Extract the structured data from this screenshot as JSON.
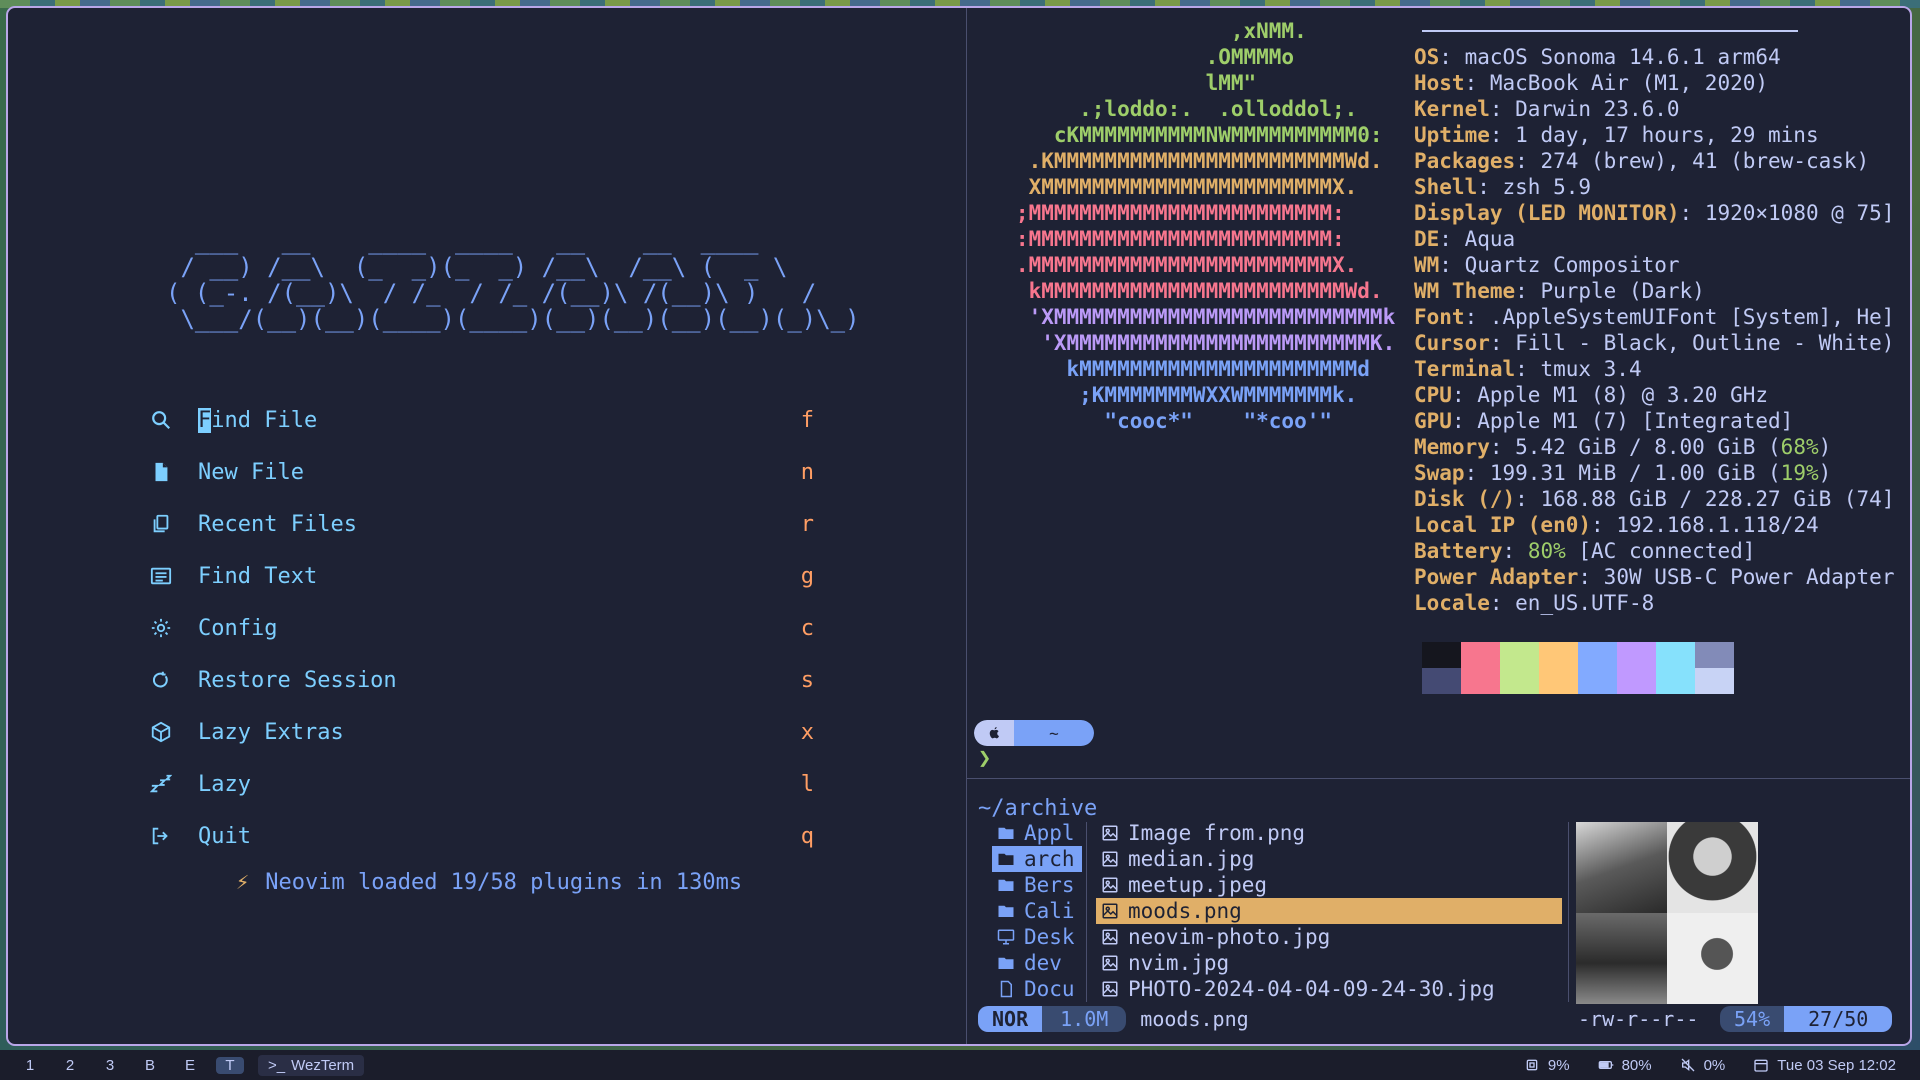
{
  "dashboard": {
    "logo_lines": [
      "  ___   __    ____  ____   __    __  ____ ",
      " / __) /__\\  (_  _)(_  _) /__\\  /__\\ (  _ \\",
      "( (_-. /(__)\\  / /_  / /_ /(__)\\ /(__)\\ )   /",
      " \\___/(__)(__)(____)(____)(__)(__)(__)(__)(_)\\_)"
    ],
    "menu": [
      {
        "icon": "search-icon",
        "label_first": "F",
        "label_rest": "ind File",
        "key": "f"
      },
      {
        "icon": "new-file-icon",
        "label": "New File",
        "key": "n"
      },
      {
        "icon": "recent-files-icon",
        "label": "Recent Files",
        "key": "r"
      },
      {
        "icon": "find-text-icon",
        "label": "Find Text",
        "key": "g"
      },
      {
        "icon": "gear-icon",
        "label": "Config",
        "key": "c"
      },
      {
        "icon": "restore-icon",
        "label": "Restore Session",
        "key": "s"
      },
      {
        "icon": "package-icon",
        "label": "Lazy Extras",
        "key": "x"
      },
      {
        "icon": "sleep-icon",
        "label": "Lazy",
        "key": "l"
      },
      {
        "icon": "quit-icon",
        "label": "Quit",
        "key": "q"
      }
    ],
    "status": "Neovim loaded 19/58 plugins in 130ms"
  },
  "fetch": {
    "ascii": [
      {
        "text": "                    ,xNMM.",
        "color": "#9ece6a"
      },
      {
        "text": "                  .OMMMMo",
        "color": "#9ece6a"
      },
      {
        "text": "                  lMM\"",
        "color": "#9ece6a"
      },
      {
        "text": "        .;loddo:.  .olloddol;.",
        "color": "#9ece6a"
      },
      {
        "text": "      cKMMMMMMMMMMNWMMMMMMMMMM0:",
        "color": "#9ece6a"
      },
      {
        "text": "    .KMMMMMMMMMMMMMMMMMMMMMMMWd.",
        "color": "#e0af68"
      },
      {
        "text": "    XMMMMMMMMMMMMMMMMMMMMMMMX.",
        "color": "#e0af68"
      },
      {
        "text": "   ;MMMMMMMMMMMMMMMMMMMMMMMM:",
        "color": "#f7768e"
      },
      {
        "text": "   :MMMMMMMMMMMMMMMMMMMMMMMM:",
        "color": "#f7768e"
      },
      {
        "text": "   .MMMMMMMMMMMMMMMMMMMMMMMMX.",
        "color": "#f7768e"
      },
      {
        "text": "    kMMMMMMMMMMMMMMMMMMMMMMMMWd.",
        "color": "#f7768e"
      },
      {
        "text": "    'XMMMMMMMMMMMMMMMMMMMMMMMMMMk",
        "color": "#bb9af7"
      },
      {
        "text": "     'XMMMMMMMMMMMMMMMMMMMMMMMMK.",
        "color": "#bb9af7"
      },
      {
        "text": "       kMMMMMMMMMMMMMMMMMMMMMMd",
        "color": "#7aa2f7"
      },
      {
        "text": "        ;KMMMMMMMWXXWMMMMMMMk.",
        "color": "#7aa2f7"
      },
      {
        "text": "          \"cooc*\"    \"*coo'\"",
        "color": "#7aa2f7"
      }
    ],
    "info": [
      {
        "k": "OS",
        "v": "macOS Sonoma 14.6.1 arm64"
      },
      {
        "k": "Host",
        "v": "MacBook Air (M1, 2020)"
      },
      {
        "k": "Kernel",
        "v": "Darwin 23.6.0"
      },
      {
        "k": "Uptime",
        "v": "1 day, 17 hours, 29 mins"
      },
      {
        "k": "Packages",
        "v": "274 (brew), 41 (brew-cask)"
      },
      {
        "k": "Shell",
        "v": "zsh 5.9"
      },
      {
        "k": "Display (LED MONITOR)",
        "v": "1920×1080 @ 75]"
      },
      {
        "k": "DE",
        "v": "Aqua"
      },
      {
        "k": "WM",
        "v": "Quartz Compositor"
      },
      {
        "k": "WM Theme",
        "v": "Purple (Dark)"
      },
      {
        "k": "Font",
        "v": ".AppleSystemUIFont [System], He]"
      },
      {
        "k": "Cursor",
        "v": "Fill - Black, Outline - White)"
      },
      {
        "k": "Terminal",
        "v": "tmux 3.4"
      },
      {
        "k": "CPU",
        "v": "Apple M1 (8) @ 3.20 GHz"
      },
      {
        "k": "GPU",
        "v": "Apple M1 (7) [Integrated]"
      },
      {
        "k": "Memory",
        "v": "5.42 GiB / 8.00 GiB (",
        "hl": "68%",
        "after": ")"
      },
      {
        "k": "Swap",
        "v": "199.31 MiB / 1.00 GiB (",
        "hl": "19%",
        "after": ")"
      },
      {
        "k": "Disk (/)",
        "v": "168.88 GiB / 228.27 GiB (74]"
      },
      {
        "k": "Local IP (en0)",
        "v": "192.168.1.118/24"
      },
      {
        "k": "Battery",
        "v": "",
        "hl": "80%",
        "after": " [AC connected]"
      },
      {
        "k": "Power Adapter",
        "v": "30W USB-C Power Adapter"
      },
      {
        "k": "Locale",
        "v": "en_US.UTF-8"
      }
    ],
    "palette_top": [
      "#15161e",
      "#f7768e",
      "#c3e88d",
      "#ffc777",
      "#82aaff",
      "#c099ff",
      "#86e1fc",
      "#828bb8"
    ],
    "palette_bottom": [
      "#444a73",
      "#f7768e",
      "#c3e88d",
      "#ffc777",
      "#82aaff",
      "#c099ff",
      "#86e1fc",
      "#c8d3f5"
    ]
  },
  "prompt": {
    "dir": "~",
    "caret": "❯"
  },
  "filemanager": {
    "path": "~/archive",
    "parent": [
      {
        "name": "Appl",
        "icon": "folder-icon"
      },
      {
        "name": "arch",
        "icon": "folder-icon",
        "selected": true
      },
      {
        "name": "Bers",
        "icon": "folder-icon"
      },
      {
        "name": "Cali",
        "icon": "folder-icon"
      },
      {
        "name": "Desk",
        "icon": "desktop-icon"
      },
      {
        "name": "dev",
        "icon": "folder-icon"
      },
      {
        "name": "Docu",
        "icon": "document-icon"
      }
    ],
    "files": [
      {
        "name": "Image from.png"
      },
      {
        "name": "median.jpg"
      },
      {
        "name": "meetup.jpeg"
      },
      {
        "name": "moods.png",
        "selected": true
      },
      {
        "name": "neovim-photo.jpg"
      },
      {
        "name": "nvim.jpg"
      },
      {
        "name": "PHOTO-2024-04-04-09-24-30.jpg"
      }
    ],
    "status": {
      "mode": "NOR",
      "size": "1.0M",
      "file": "moods.png",
      "perms": "-rw-r--r--",
      "percent": "54%",
      "position": "27/50"
    }
  },
  "bottombar": {
    "workspaces": [
      "1",
      "2",
      "3",
      "B",
      "E",
      "T"
    ],
    "active_workspace": "T",
    "app": "WezTerm",
    "cpu": "9%",
    "battery": "80%",
    "volume": "0%",
    "datetime": "Tue 03 Sep 12:02"
  }
}
